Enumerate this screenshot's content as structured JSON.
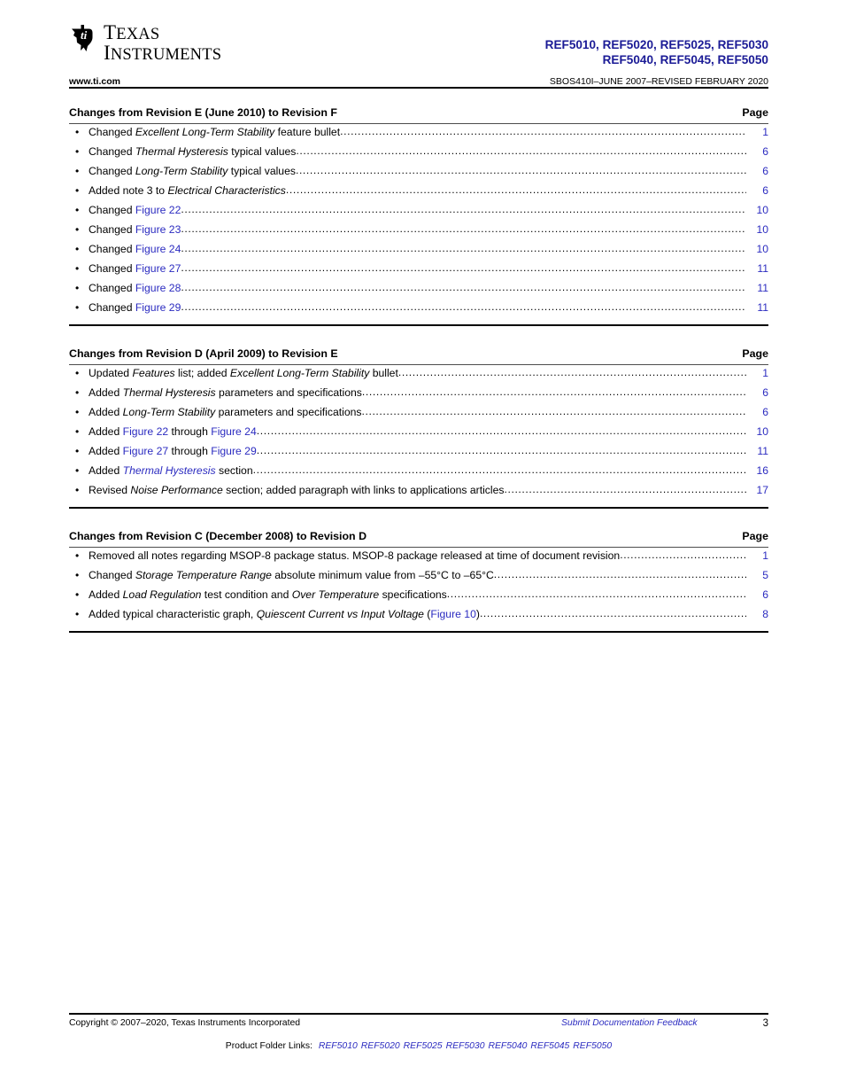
{
  "header": {
    "logo_text_line1": "TEXAS",
    "logo_text_line2": "INSTRUMENTS",
    "logo_icon": "ti-texas-logo-icon",
    "part_numbers_line1": "REF5010, REF5020, REF5025, REF5030",
    "part_numbers_line2": "REF5040, REF5045, REF5050",
    "url": "www.ti.com",
    "doc_id": "SBOS410I–JUNE 2007–REVISED FEBRUARY 2020",
    "partno_color": "#1b1b96"
  },
  "link_color": "#2b2bc0",
  "sections": [
    {
      "title": "Changes from Revision E (June 2010) to Revision F",
      "page_label": "Page",
      "bullets": [
        {
          "bullet": "•",
          "page": "1",
          "parts": [
            {
              "t": "Changed ",
              "style": "plain"
            },
            {
              "t": "Excellent Long-Term Stability",
              "style": "italic"
            },
            {
              "t": " feature bullet ",
              "style": "plain"
            }
          ]
        },
        {
          "bullet": "•",
          "page": "6",
          "parts": [
            {
              "t": "Changed ",
              "style": "plain"
            },
            {
              "t": "Thermal Hysteresis",
              "style": "italic"
            },
            {
              "t": " typical values ",
              "style": "plain"
            }
          ]
        },
        {
          "bullet": "•",
          "page": "6",
          "parts": [
            {
              "t": "Changed ",
              "style": "plain"
            },
            {
              "t": "Long-Term Stability",
              "style": "italic"
            },
            {
              "t": " typical values ",
              "style": "plain"
            }
          ]
        },
        {
          "bullet": "•",
          "page": "6",
          "parts": [
            {
              "t": "Added note 3 to ",
              "style": "plain"
            },
            {
              "t": "Electrical Characteristics",
              "style": "italic"
            }
          ]
        },
        {
          "bullet": "•",
          "page": "10",
          "parts": [
            {
              "t": "Changed ",
              "style": "plain"
            },
            {
              "t": "Figure 22",
              "style": "link"
            }
          ]
        },
        {
          "bullet": "•",
          "page": "10",
          "parts": [
            {
              "t": "Changed ",
              "style": "plain"
            },
            {
              "t": "Figure 23",
              "style": "link"
            }
          ]
        },
        {
          "bullet": "•",
          "page": "10",
          "parts": [
            {
              "t": "Changed ",
              "style": "plain"
            },
            {
              "t": "Figure 24",
              "style": "link"
            }
          ]
        },
        {
          "bullet": "•",
          "page": "11",
          "parts": [
            {
              "t": "Changed ",
              "style": "plain"
            },
            {
              "t": "Figure 27",
              "style": "link"
            }
          ]
        },
        {
          "bullet": "•",
          "page": "11",
          "parts": [
            {
              "t": "Changed ",
              "style": "plain"
            },
            {
              "t": "Figure 28",
              "style": "link"
            }
          ]
        },
        {
          "bullet": "•",
          "page": "11",
          "parts": [
            {
              "t": "Changed ",
              "style": "plain"
            },
            {
              "t": "Figure 29",
              "style": "link"
            }
          ]
        }
      ]
    },
    {
      "title": "Changes from Revision D (April 2009) to Revision E",
      "page_label": "Page",
      "bullets": [
        {
          "bullet": "•",
          "page": "1",
          "parts": [
            {
              "t": "Updated ",
              "style": "plain"
            },
            {
              "t": "Features",
              "style": "italic"
            },
            {
              "t": " list; added ",
              "style": "plain"
            },
            {
              "t": "Excellent Long-Term Stability",
              "style": "italic"
            },
            {
              "t": " bullet ",
              "style": "plain"
            }
          ]
        },
        {
          "bullet": "•",
          "page": "6",
          "parts": [
            {
              "t": "Added ",
              "style": "plain"
            },
            {
              "t": "Thermal Hysteresis",
              "style": "italic"
            },
            {
              "t": " parameters and specifications ",
              "style": "plain"
            }
          ]
        },
        {
          "bullet": "•",
          "page": "6",
          "parts": [
            {
              "t": "Added ",
              "style": "plain"
            },
            {
              "t": "Long-Term Stability",
              "style": "italic"
            },
            {
              "t": " parameters and specifications ",
              "style": "plain"
            }
          ]
        },
        {
          "bullet": "•",
          "page": "10",
          "parts": [
            {
              "t": "Added ",
              "style": "plain"
            },
            {
              "t": "Figure 22",
              "style": "link"
            },
            {
              "t": " through ",
              "style": "plain"
            },
            {
              "t": "Figure 24",
              "style": "link"
            },
            {
              "t": " ",
              "style": "plain"
            }
          ]
        },
        {
          "bullet": "•",
          "page": "11",
          "parts": [
            {
              "t": "Added ",
              "style": "plain"
            },
            {
              "t": "Figure 27",
              "style": "link"
            },
            {
              "t": " through ",
              "style": "plain"
            },
            {
              "t": "Figure 29",
              "style": "link"
            },
            {
              "t": " ",
              "style": "plain"
            }
          ]
        },
        {
          "bullet": "•",
          "page": "16",
          "parts": [
            {
              "t": "Added  ",
              "style": "plain"
            },
            {
              "t": "Thermal Hysteresis",
              "style": "link-italic"
            },
            {
              "t": " section",
              "style": "plain"
            }
          ]
        },
        {
          "bullet": "•",
          "page": "17",
          "parts": [
            {
              "t": "Revised ",
              "style": "plain"
            },
            {
              "t": "Noise Performance",
              "style": "italic"
            },
            {
              "t": " section; added paragraph with links to applications articles ",
              "style": "plain"
            }
          ]
        }
      ]
    },
    {
      "title": "Changes from Revision C (December 2008) to Revision D",
      "page_label": "Page",
      "bullets": [
        {
          "bullet": "•",
          "page": "1",
          "parts": [
            {
              "t": "Removed all notes regarding MSOP-8 package status. MSOP-8 package released at time of document revision",
              "style": "plain"
            }
          ]
        },
        {
          "bullet": "•",
          "page": "5",
          "parts": [
            {
              "t": "Changed ",
              "style": "plain"
            },
            {
              "t": "Storage Temperature Range",
              "style": "italic"
            },
            {
              "t": " absolute minimum value from –55°C to –65°C",
              "style": "plain"
            }
          ]
        },
        {
          "bullet": "•",
          "page": "6",
          "parts": [
            {
              "t": "Added ",
              "style": "plain"
            },
            {
              "t": "Load Regulation",
              "style": "italic"
            },
            {
              "t": " test condition and ",
              "style": "plain"
            },
            {
              "t": "Over Temperature",
              "style": "italic"
            },
            {
              "t": " specifications ",
              "style": "plain"
            }
          ]
        },
        {
          "bullet": "•",
          "page": "8",
          "parts": [
            {
              "t": "Added typical characteristic graph, ",
              "style": "plain"
            },
            {
              "t": "Quiescent Current vs Input Voltage",
              "style": "italic"
            },
            {
              "t": " (",
              "style": "plain"
            },
            {
              "t": "Figure 10",
              "style": "link"
            },
            {
              "t": ") ",
              "style": "plain"
            }
          ]
        }
      ]
    }
  ],
  "footer": {
    "copyright": "Copyright © 2007–2020, Texas Instruments Incorporated",
    "feedback": "Submit Documentation Feedback",
    "page_number": "3",
    "product_folder_label": "Product Folder Links:",
    "product_links": [
      "REF5010",
      "REF5020",
      "REF5025",
      "REF5030",
      "REF5040",
      "REF5045",
      "REF5050"
    ]
  }
}
